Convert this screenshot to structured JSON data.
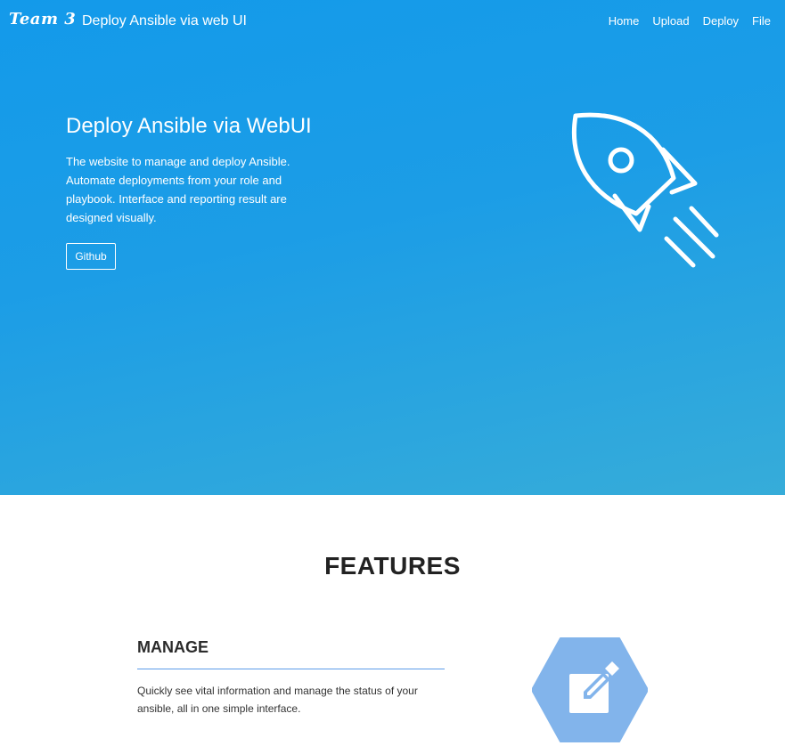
{
  "navbar": {
    "brand": "Team 3",
    "site_title": "Deploy Ansible via web UI",
    "links": [
      "Home",
      "Upload",
      "Deploy",
      "File"
    ]
  },
  "hero": {
    "heading": "Deploy Ansible via WebUI",
    "description": "The website to manage and deploy Ansible. Automate deployments from your role and playbook. Interface and reporting result are designed visually.",
    "button_label": "Github",
    "illustration": "rocket-icon"
  },
  "features": {
    "title": "FEATURES",
    "items": [
      {
        "heading": "MANAGE",
        "text": "Quickly see vital information and manage the status of your ansible, all in one simple interface.",
        "icon": "edit-icon"
      }
    ]
  },
  "colors": {
    "hero_gradient_start": "#139aea",
    "hero_gradient_end": "#36acd9",
    "accent_rule": "#5b9bea",
    "hexagon_fill": "#82b4eb"
  }
}
